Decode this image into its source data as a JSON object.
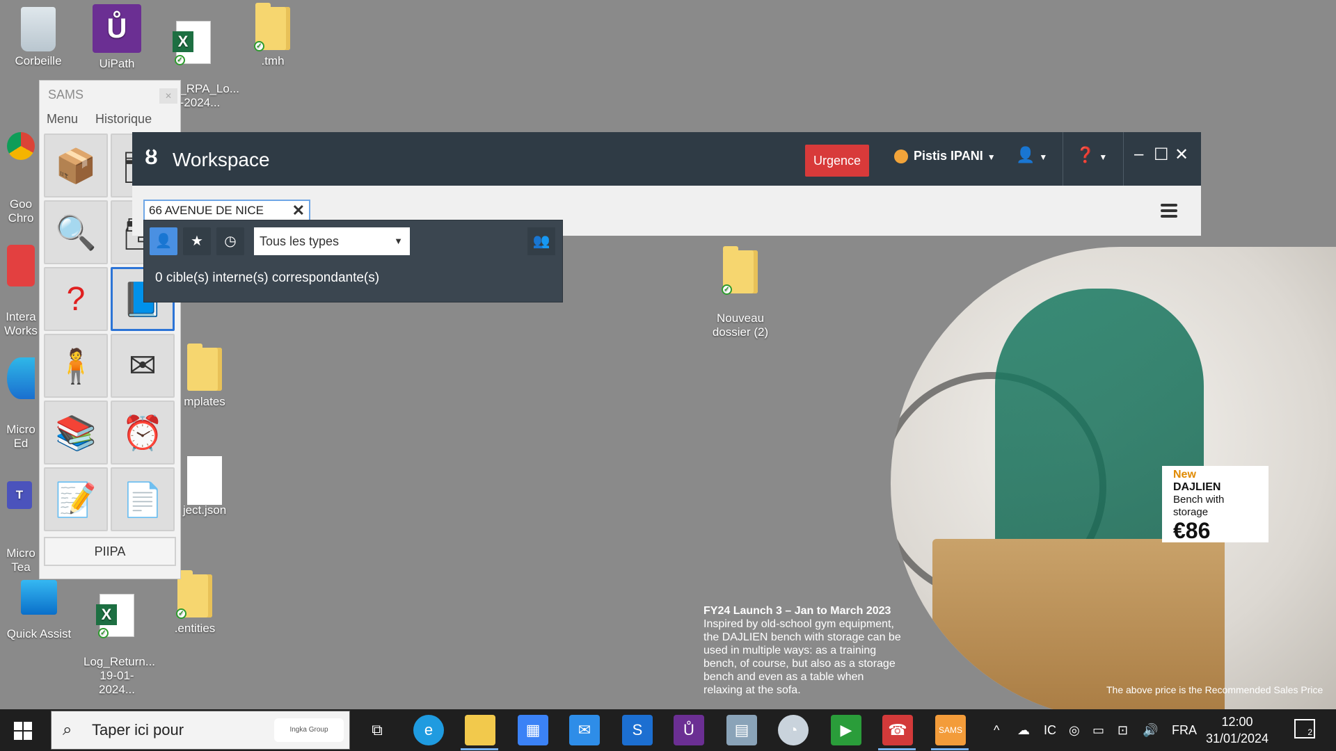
{
  "desktop": {
    "icons": [
      {
        "label": "Corbeille"
      },
      {
        "label": "UiPath"
      },
      {
        "label": "WR_RPA_Lo...\n01-2024..."
      },
      {
        "label": ".tmh"
      },
      {
        "label": "Goo\nChro"
      },
      {
        "label": "Intera\nWorks"
      },
      {
        "label": "Micro\nEd"
      },
      {
        "label": "Micro\nTea"
      },
      {
        "label": "mplates"
      },
      {
        "label": "ject.json"
      },
      {
        "label": "Quick Assist"
      },
      {
        "label": "Log_Return...\n19-01-2024..."
      },
      {
        "label": ".entities"
      },
      {
        "label": "Nouveau\ndossier (2)"
      }
    ]
  },
  "sams": {
    "title": "SAMS",
    "menu": [
      "Menu",
      "Historique"
    ],
    "footer_button": "PIIPA"
  },
  "workspace": {
    "app_title": "Workspace",
    "urgence_label": "Urgence",
    "user_name": "Pistis IPANI",
    "search_value": "66 AVENUE DE NICE",
    "type_filter": "Tous les types",
    "result_text": "0 cible(s) interne(s) correspondante(s)"
  },
  "wallpaper": {
    "badge_new": "New",
    "product_name": "DAJLIEN",
    "product_desc": "Bench with storage",
    "price": "€86",
    "headline": "FY24 Launch 3 – Jan to March 2023",
    "body": "Inspired by old-school gym equipment, the DAJLIEN bench with storage can be used in multiple ways: as a training bench, of course, but also as a storage bench and even as a table when relaxing at the sofa.",
    "disclaimer": "The above price is the Recommended Sales Price"
  },
  "taskbar": {
    "search_placeholder": "Taper ici pour",
    "search_badge": "Ingka Group",
    "language": "FRA",
    "time": "12:00",
    "date": "31/01/2024",
    "notification_count": "2"
  },
  "colors": {
    "workspace_bar": "#2f3b45",
    "urgence": "#d83a3a",
    "accent": "#2c74d6"
  }
}
